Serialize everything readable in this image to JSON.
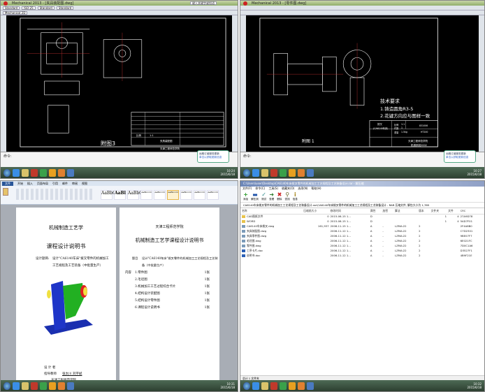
{
  "cad_left": {
    "app_title": "Mechanical 2013 - [夹具装配图.dwg]",
    "search_placeholder": "键入关键字或短语",
    "toolbar_styles": [
      "Standard",
      "ISO-25",
      "Standard",
      "Standard"
    ],
    "layer": "Mechanical 2D",
    "drawing_label": "附图3",
    "title_block": {
      "name": "夹具装配图",
      "school": "天津工程师范学院",
      "scale_label": "比例",
      "scale": "1:1"
    },
    "command_text": "命令:",
    "tooltip": {
      "title": "远程订阅服务更新",
      "text": "单击以获取更新信息"
    },
    "clock": {
      "time": "10:24",
      "date": "2015/6/18"
    }
  },
  "cad_right": {
    "app_title": "Mechanical 2013 - [零件图.dwg]",
    "drawing_label": "附图 1",
    "tech_title": "技术要求",
    "tech_items": [
      "1.铸造圆角R3-5",
      "2.花键方向应与图样一致"
    ],
    "title_block": {
      "part": "拨叉",
      "part_code": "(CA6140车床)",
      "scale_label": "比例",
      "scale": "1:1",
      "count_label": "件数",
      "count": "1",
      "weight_label": "重量",
      "weight": "1.5kg",
      "material": "HT200",
      "code": "831006",
      "school": "天津工程师范学院",
      "dept": "机械系制2002"
    },
    "command_text": "命令:",
    "tooltip": {
      "title": "远程订阅服务更新",
      "text": "单击以获取更新信息"
    },
    "clock": {
      "time": "10:27",
      "date": "2015/6/18"
    }
  },
  "word": {
    "tabs": [
      "文件",
      "开始",
      "插入",
      "页面布局",
      "引用",
      "邮件",
      "审阅",
      "视图"
    ],
    "styles": [
      "AaBbC",
      "AaBl",
      "AaBbC",
      "AaBbCcD",
      "AaBbCcD",
      "AaBbCcD",
      "AaBbCcD",
      "AaBbCcD",
      "AaBbCcD",
      "AaBbCcD",
      "AaBbCcD"
    ],
    "page1": {
      "title": "机械制造工艺学",
      "subtitle": "课程设计说明书",
      "topic_label": "设计题目:",
      "topic_line1": "设计\"CA6140车床\"拨叉零件的机械加工",
      "topic_line2": "工艺规程及工艺装备（中批量生产）",
      "designer_label": "设 计 者",
      "advisor_label": "指导教师",
      "advisor": "张太川  刘宇斌",
      "footer": "天津工程师范学院"
    },
    "page2": {
      "school": "天津工程师范学院",
      "title": "机械制造工艺学课程设计说明书",
      "topic_label": "题目",
      "topic_line1": "设计\"CA6140车床\"拨叉零件的机械加工工艺规程及工艺装",
      "topic_line2": "备（中批量生产）",
      "content_label": "内容",
      "toc": [
        "1.零件图",
        "2.毛坯图",
        "3.机械加工工艺过程综合卡片",
        "4.结构设计装配图",
        "5.结构设计零件图",
        "6.课程设计说明书"
      ],
      "toc_page": "1张"
    },
    "clock": {
      "time": "10:31",
      "date": "2015/6/18"
    }
  },
  "filemanager": {
    "title": "C:\\Users\\user\\Desktop\\CA6140车床拨叉零件的机械加工工艺规程及工艺装备设计.rar - 解压缩",
    "menu": [
      "文件(F)",
      "命令(C)",
      "工具(S)",
      "收藏夹(O)",
      "选项(N)",
      "帮助(H)"
    ],
    "tools": [
      {
        "label": "添加",
        "icon": "+",
        "color": "#2a9a2a"
      },
      {
        "label": "解压到",
        "icon": "▬",
        "color": "#2255aa"
      },
      {
        "label": "测试",
        "icon": "✓",
        "color": "#2a8a8a"
      },
      {
        "label": "查看",
        "icon": "➜",
        "color": "#2a7a2a"
      },
      {
        "label": "删除",
        "icon": "✖",
        "color": "#cc2222"
      },
      {
        "label": "查找",
        "icon": "⚲",
        "color": "#6a6a2a"
      },
      {
        "label": "信息",
        "icon": "i",
        "color": "#aa8a22"
      }
    ],
    "address": "CA6140车床拨叉零件的机械加工工艺规程及工艺装备设计.rar\\CA6140车床拨叉零件的机械加工工艺规程及工艺装备设计 - RAR 压缩文件, 解包大小为 1,785",
    "columns": [
      "名称",
      "压缩前大小",
      "修改时间",
      "属性",
      "加密",
      "算法",
      "版本",
      "文件夹",
      "文件",
      "CRC"
    ],
    "rows": [
      {
        "name": "CAD图纸文件",
        "type": "folder",
        "size": "0",
        "date": "2015-06-15 1...",
        "attr": "D",
        "enc": "",
        "algo": "",
        "ver": "",
        "folders": "1",
        "files": "4",
        "crc": "27A9D78"
      },
      {
        "name": "WORD",
        "type": "folder",
        "size": "0",
        "date": "2015-06-15 1...",
        "attr": "D",
        "enc": "",
        "algo": "",
        "ver": "",
        "folders": "1",
        "files": "4",
        "crc": "5AD7F01"
      },
      {
        "name": "CA6140车床拨叉.dwg",
        "type": "dwg",
        "size": "161,937",
        "date": "2006-11-15 1...",
        "attr": "A",
        "enc": "-",
        "algo": "LZMA:22",
        "ver": "2",
        "folders": "",
        "files": "",
        "crc": "2F4A8B0"
      },
      {
        "name": "夹具装配图.dwg",
        "type": "dwg",
        "size": "",
        "date": "2006-11-12 1...",
        "attr": "A",
        "enc": "-",
        "algo": "LZMA:22",
        "ver": "2",
        "folders": "",
        "files": "",
        "crc": "C7D2301"
      },
      {
        "name": "夹具零件图.dwg",
        "type": "dwg",
        "size": "",
        "date": "2006-11-12 1...",
        "attr": "A",
        "enc": "-",
        "algo": "LZMA:22",
        "ver": "2",
        "folders": "",
        "files": "",
        "crc": "9BE07F7"
      },
      {
        "name": "毛坯图.dwg",
        "type": "dwg",
        "size": "",
        "date": "2006-11-12 1...",
        "attr": "A",
        "enc": "-",
        "algo": "LZMA:22",
        "ver": "2",
        "folders": "",
        "files": "",
        "crc": "6E021FC"
      },
      {
        "name": "零件图.dwg",
        "type": "dwg",
        "size": "",
        "date": "2006-11-12 1...",
        "attr": "A",
        "enc": "-",
        "algo": "LZMA:22",
        "ver": "2",
        "folders": "",
        "files": "",
        "crc": "7D0C1A6"
      },
      {
        "name": "工序卡片.doc",
        "type": "doc",
        "size": "",
        "date": "2006-11-12 1...",
        "attr": "A",
        "enc": "-",
        "algo": "LZMA:22",
        "ver": "2",
        "folders": "",
        "files": "",
        "crc": "D3527F1"
      },
      {
        "name": "说明书.doc",
        "type": "doc",
        "size": "",
        "date": "2006-11-12 1...",
        "attr": "A",
        "enc": "-",
        "algo": "LZMA:22",
        "ver": "2",
        "folders": "",
        "files": "",
        "crc": "4B9F21E"
      }
    ],
    "status": "总计 1 文件夹",
    "clock": {
      "time": "10:32",
      "date": "2015/6/18"
    }
  },
  "taskbar_colors": [
    "#3a8ee6",
    "#d9c36a",
    "#c0392b",
    "#3aa04a",
    "#e8a020",
    "#e08030",
    "#4a7ac0",
    "#999999"
  ]
}
